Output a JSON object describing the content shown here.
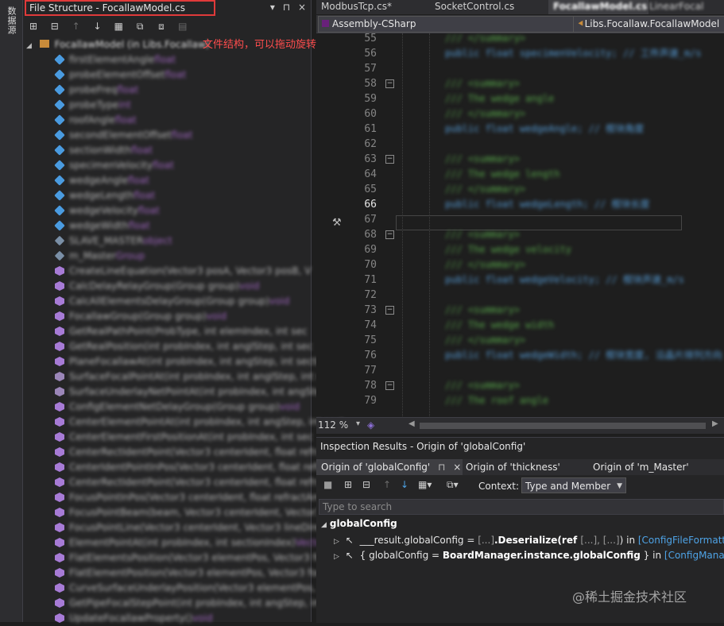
{
  "left_strip": {
    "label": "数据源"
  },
  "file_structure": {
    "title": "File Structure - FocallawModel.cs",
    "ctrl_pin": "▾",
    "ctrl_dock": "⊓",
    "ctrl_close": "×",
    "root": "FocallawModel (in Libs.Focallaw)",
    "items": [
      {
        "kind": "field",
        "name": "firstElementAngle",
        "type": "float"
      },
      {
        "kind": "field",
        "name": "probeElementOffset",
        "type": "float"
      },
      {
        "kind": "field",
        "name": "probeFreq",
        "type": "float"
      },
      {
        "kind": "field",
        "name": "probeType",
        "type": "int"
      },
      {
        "kind": "field",
        "name": "roofAngle",
        "type": "float"
      },
      {
        "kind": "field",
        "name": "secondElementOffset",
        "type": "float"
      },
      {
        "kind": "field",
        "name": "sectionWidth",
        "type": "float"
      },
      {
        "kind": "field",
        "name": "specimenVelocity",
        "type": "float"
      },
      {
        "kind": "field",
        "name": "wedgeAngle",
        "type": "float"
      },
      {
        "kind": "field",
        "name": "wedgeLength",
        "type": "float"
      },
      {
        "kind": "field",
        "name": "wedgeVelocity",
        "type": "float"
      },
      {
        "kind": "field",
        "name": "wedgeWidth",
        "type": "float"
      },
      {
        "kind": "lock",
        "name": "SLAVE_MASTER",
        "type": "object"
      },
      {
        "kind": "lock",
        "name": "m_Master",
        "type": "Group"
      },
      {
        "kind": "method",
        "name": "CreateLineEquation(Vector3 posA, Vector3 posB, V",
        "type": ""
      },
      {
        "kind": "method",
        "name": "CalcDelayRelayGroup(Group group)",
        "type": "void"
      },
      {
        "kind": "method",
        "name": "CalcAllElementsDelayGroup(Group group)",
        "type": "void"
      },
      {
        "kind": "method",
        "name": "FocallawGroup(Group group)",
        "type": "void"
      },
      {
        "kind": "method",
        "name": "GetRealPathPoint(ProbType, int elemIndex, int sec",
        "type": ""
      },
      {
        "kind": "method",
        "name": "GetRealPosition(int probIndex, int anglStep, int sec",
        "type": ""
      },
      {
        "kind": "method",
        "name": "PlaneFocallawAt(int probIndex, int angStep, int section",
        "type": ""
      },
      {
        "kind": "lockm",
        "name": "SurfaceFocalPointAt(int probIndex, int anglStep, int sec",
        "type": ""
      },
      {
        "kind": "lockm",
        "name": "SurfaceUnderlayNetPointAt(int probIndex, int angStep",
        "type": ""
      },
      {
        "kind": "method",
        "name": "ConfigElementNetDelayGroup(Group group)",
        "type": "void"
      },
      {
        "kind": "method",
        "name": "CenterElementPointAt(int probIndex, int angStep, int sect",
        "type": ""
      },
      {
        "kind": "method",
        "name": "CenterElementFirstPositionAt(int probIndex, int sec",
        "type": ""
      },
      {
        "kind": "method",
        "name": "CenterRectIdentPoint(Vector3 centerIdent, float refra",
        "type": ""
      },
      {
        "kind": "method",
        "name": "CenterIdentPointInPos(Vector3 centerIdent, float refra",
        "type": ""
      },
      {
        "kind": "method",
        "name": "CenterRectIdentPoint(Vector3 centerIdent, float refra",
        "type": ""
      },
      {
        "kind": "method",
        "name": "FocusPointInPos(Vector3 centerIdent, float refractAngle",
        "type": ""
      },
      {
        "kind": "method",
        "name": "FocusPointBeam(beam, Vector3 centerIdent, Vector3",
        "type": ""
      },
      {
        "kind": "method",
        "name": "FocusPointLine(Vector3 centerIdent, Vector3 lineDirect",
        "type": ""
      },
      {
        "kind": "method",
        "name": "ElementPointAt(int probIndex, int sectionIndex)",
        "type": "Vector3"
      },
      {
        "kind": "method",
        "name": "FlatElementsPosition(Vector3 elementPos, Vector3 foc",
        "type": ""
      },
      {
        "kind": "method",
        "name": "FlatElementPosition(Vector3 elementPos, Vector3 focu",
        "type": ""
      },
      {
        "kind": "method",
        "name": "CurveSurfaceUnderlayPosition(Vector3 elementPos, Vec",
        "type": ""
      },
      {
        "kind": "method",
        "name": "GetPipeFocalStepPoint(int probIndex, int angStep, int sect",
        "type": ""
      },
      {
        "kind": "method",
        "name": "UpdateFocallawProperty()",
        "type": "void"
      }
    ]
  },
  "annotation": "文件结构，可以拖动旋转的成员或者方法进行调整其在类中的位置",
  "editor": {
    "tabs": [
      "ModbusTcp.cs*",
      "SocketControl.cs",
      "FocallawModel.cs",
      "LinearFocal"
    ],
    "project_combo": "Assembly-CSharp",
    "member_combo": "Libs.Focallaw.FocallawModel",
    "lines": [
      {
        "n": "55",
        "fold": false,
        "code": "/// </summary>",
        "kind": "c"
      },
      {
        "n": "56",
        "fold": false,
        "code": "public float specimenVelocity; // 工件声速_m/s",
        "kind": "k"
      },
      {
        "n": "57",
        "fold": false,
        "code": "",
        "kind": "c"
      },
      {
        "n": "58",
        "fold": true,
        "code": "/// <summary>",
        "kind": "c"
      },
      {
        "n": "59",
        "fold": false,
        "code": "/// The wedge angle",
        "kind": "c"
      },
      {
        "n": "60",
        "fold": false,
        "code": "/// </summary>",
        "kind": "c"
      },
      {
        "n": "61",
        "fold": false,
        "code": "public float wedgeAngle; // 楔块角度",
        "kind": "k"
      },
      {
        "n": "62",
        "fold": false,
        "code": "",
        "kind": "c"
      },
      {
        "n": "63",
        "fold": true,
        "code": "/// <summary>",
        "kind": "c"
      },
      {
        "n": "64",
        "fold": false,
        "code": "/// The wedge length",
        "kind": "c"
      },
      {
        "n": "65",
        "fold": false,
        "code": "/// </summary>",
        "kind": "c"
      },
      {
        "n": "66",
        "fold": false,
        "code": "public float wedgeLength; // 楔块长度",
        "kind": "k"
      },
      {
        "n": "67",
        "fold": false,
        "code": "",
        "kind": "c"
      },
      {
        "n": "68",
        "fold": true,
        "code": "/// <summary>",
        "kind": "c"
      },
      {
        "n": "69",
        "fold": false,
        "code": "/// The wedge velocity",
        "kind": "c"
      },
      {
        "n": "70",
        "fold": false,
        "code": "/// </summary>",
        "kind": "c"
      },
      {
        "n": "71",
        "fold": false,
        "code": "public float wedgeVelocity; // 楔块声速_m/s",
        "kind": "k"
      },
      {
        "n": "72",
        "fold": false,
        "code": "",
        "kind": "c"
      },
      {
        "n": "73",
        "fold": true,
        "code": "/// <summary>",
        "kind": "c"
      },
      {
        "n": "74",
        "fold": false,
        "code": "/// The wedge width",
        "kind": "c"
      },
      {
        "n": "75",
        "fold": false,
        "code": "/// </summary>",
        "kind": "c"
      },
      {
        "n": "76",
        "fold": false,
        "code": "public float wedgeWidth; // 楔块宽度, 沿晶片排列方向",
        "kind": "k"
      },
      {
        "n": "77",
        "fold": false,
        "code": "",
        "kind": "c"
      },
      {
        "n": "78",
        "fold": true,
        "code": "/// <summary>",
        "kind": "c"
      },
      {
        "n": "79",
        "fold": false,
        "code": "/// The roof angle",
        "kind": "c"
      }
    ],
    "current_line": "66",
    "zoom": "112 %"
  },
  "inspection": {
    "title": "Inspection Results - Origin of 'globalConfig'",
    "tabs": [
      "Origin of 'globalConfig'",
      "Origin of 'thickness'",
      "Origin of 'm_Master'"
    ],
    "tab_pin": "⊓",
    "tab_close": "×",
    "context_label": "Context:",
    "context_value": "Type and Member",
    "search_placeholder": "Type to search",
    "root": "globalConfig",
    "rows": [
      {
        "lead": "___result.globalConfig = ",
        "gray1": "[...]",
        "bold": ".Deserialize(ref ",
        "gray2": "[...], [...]",
        "tail": ") in ",
        "link": "[ConfigFileFormatter.De"
      },
      {
        "lead": "{ globalConfig = ",
        "gray1": "",
        "bold": "BoardManager.instance.globalConfig",
        "gray2": "",
        "tail": " } in ",
        "link": "[ConfigManager.S"
      }
    ]
  },
  "watermark": "@稀土掘金技术社区"
}
